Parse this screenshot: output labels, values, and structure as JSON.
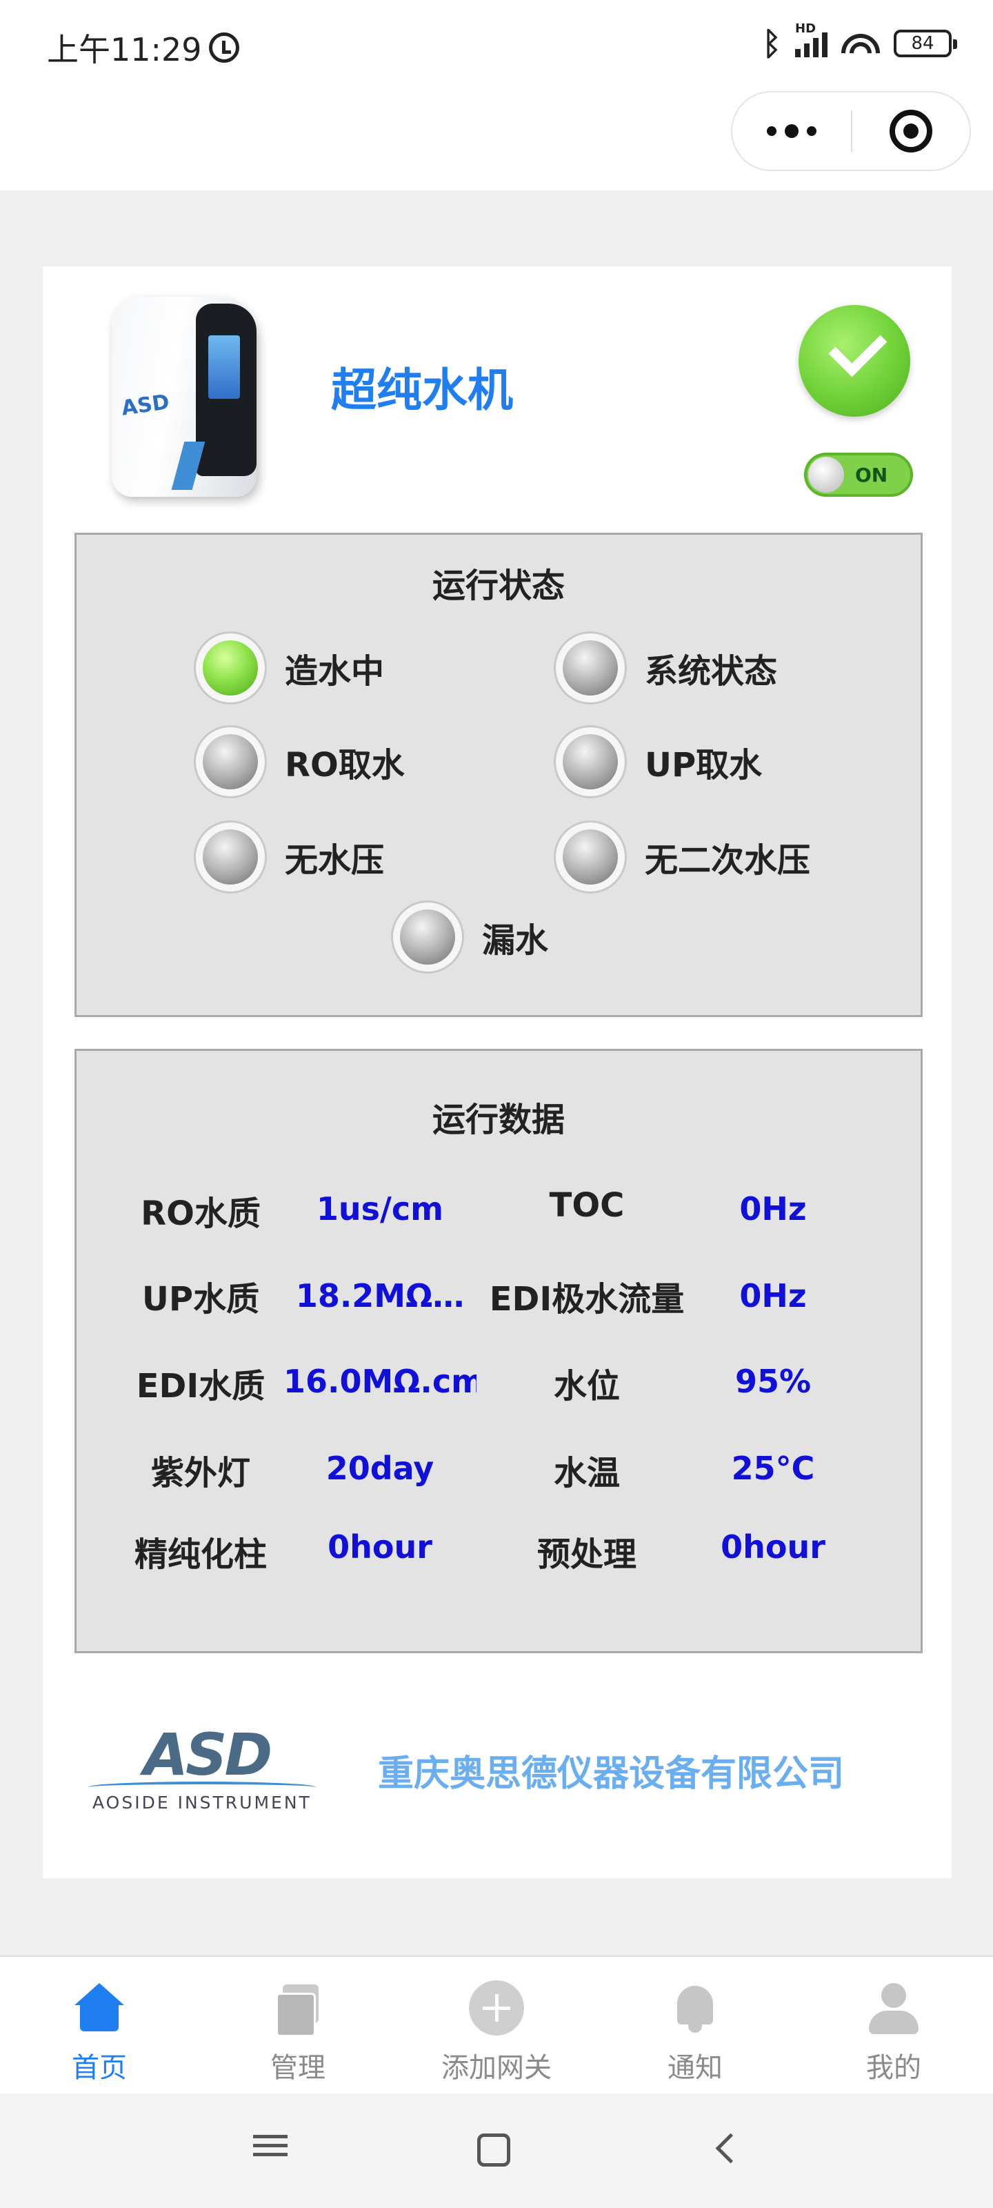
{
  "status_bar": {
    "time": "上午11:29",
    "hd_label": "HD",
    "battery": "84"
  },
  "header": {
    "app_title": "超纯水机"
  },
  "device": {
    "logo_text": "ASD",
    "power_state": "ON",
    "status_ok": true
  },
  "run_status": {
    "title": "运行状态",
    "indicators": [
      {
        "label": "造水中",
        "active": true
      },
      {
        "label": "系统状态",
        "active": false
      },
      {
        "label": "RO取水",
        "active": false
      },
      {
        "label": "UP取水",
        "active": false
      },
      {
        "label": "无水压",
        "active": false
      },
      {
        "label": "无二次水压",
        "active": false
      },
      {
        "label": "漏水",
        "active": false
      }
    ]
  },
  "run_data": {
    "title": "运行数据",
    "rows": [
      {
        "l1": "RO水质",
        "v1": "1us/cm",
        "l2": "TOC",
        "v2": "0Hz"
      },
      {
        "l1": "UP水质",
        "v1": "18.2MΩ…",
        "l2": "EDI极水流量",
        "v2": "0Hz"
      },
      {
        "l1": "EDI水质",
        "v1": "16.0MΩ.cm",
        "l2": "水位",
        "v2": "95%"
      },
      {
        "l1": "紫外灯",
        "v1": "20day",
        "l2": "水温",
        "v2": "25°C"
      },
      {
        "l1": "精纯化柱",
        "v1": "0hour",
        "l2": "预处理",
        "v2": "0hour"
      }
    ]
  },
  "footer": {
    "logo_mark": "ASD",
    "logo_sub": "AOSIDE INSTRUMENT",
    "company": "重庆奥思德仪器设备有限公司"
  },
  "tabbar": [
    {
      "label": "首页",
      "icon": "home-icon",
      "active": true
    },
    {
      "label": "管理",
      "icon": "manage-icon",
      "active": false
    },
    {
      "label": "添加网关",
      "icon": "add-gateway-icon",
      "active": false
    },
    {
      "label": "通知",
      "icon": "bell-icon",
      "active": false
    },
    {
      "label": "我的",
      "icon": "profile-icon",
      "active": false
    }
  ],
  "colors": {
    "accent": "#1f7ff0",
    "value_blue": "#1010d8",
    "active_led": "#8ee14a"
  }
}
